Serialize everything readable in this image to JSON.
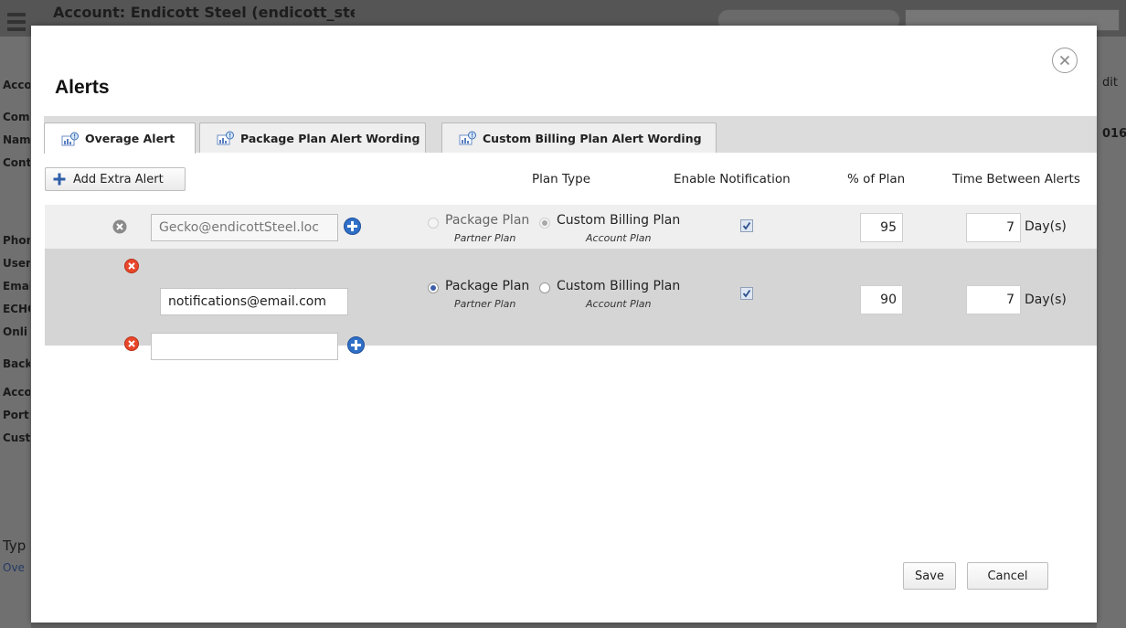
{
  "background": {
    "title": "Account: Endicott Steel (endicott_steel)",
    "left_labels": [
      "Acco",
      "Com",
      "Nam",
      "Cont",
      "Phon",
      "User",
      "Emai",
      "ECHO",
      "Onli",
      "Back",
      "Acco",
      "Port",
      "Cust",
      "Typ",
      "Ove"
    ],
    "right_labels": [
      "dit",
      "016"
    ]
  },
  "modal": {
    "title": "Alerts",
    "close_icon": "close-circle-icon"
  },
  "tabs": [
    {
      "label": "Overage Alert",
      "active": true,
      "icon": "alert-chart-icon"
    },
    {
      "label": "Package Plan Alert Wording",
      "active": false,
      "icon": "alert-chart-icon"
    },
    {
      "label": "Custom Billing Plan Alert Wording",
      "active": false,
      "icon": "alert-chart-icon"
    }
  ],
  "toolbar": {
    "add_label": "Add Extra Alert"
  },
  "columns": {
    "plan_type": "Plan Type",
    "enable_notification": "Enable Notification",
    "percent_of_plan": "% of Plan",
    "time_between_alerts": "Time Between Alerts"
  },
  "plan_options": {
    "package": "Package Plan",
    "package_sub": "Partner Plan",
    "custom": "Custom Billing Plan",
    "custom_sub": "Account Plan"
  },
  "alerts": [
    {
      "email": "Gecko@endicottSteel.loc",
      "editable": false,
      "plan": "custom",
      "enable_notification": true,
      "percent": "95",
      "days": "7",
      "unit": "Day(s)"
    },
    {
      "email": "notifications@email.com",
      "editable": true,
      "plan": "package",
      "enable_notification": true,
      "percent": "90",
      "days": "7",
      "unit": "Day(s)"
    },
    {
      "email": "",
      "editable": true
    }
  ],
  "footer": {
    "save_label": "Save",
    "cancel_label": "Cancel"
  },
  "colors": {
    "delete_red": "#e8472a",
    "delete_gray": "#8a8a8a",
    "add_blue": "#2f6fc7",
    "radio_blue": "#3b5fa8"
  }
}
